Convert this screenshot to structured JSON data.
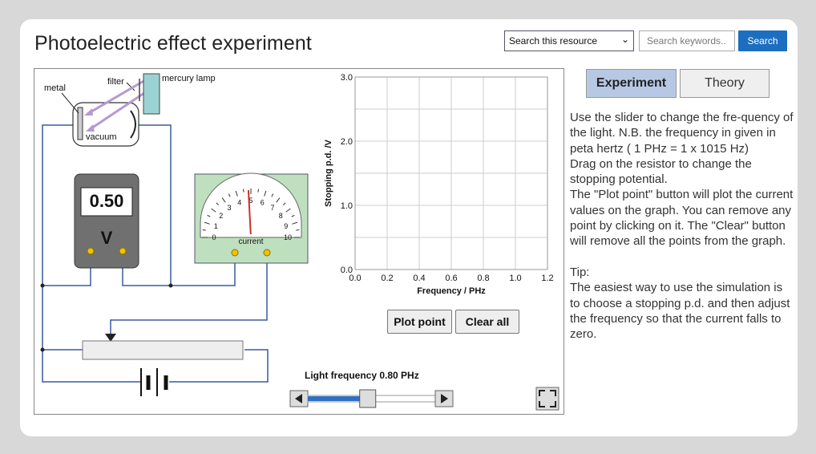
{
  "header": {
    "title": "Photoelectric effect experiment",
    "search_select": "Search this resource",
    "search_placeholder": "Search keywords..",
    "search_button": "Search"
  },
  "apparatus": {
    "metal_label": "metal",
    "filter_label": "filter",
    "lamp_label": "mercury lamp",
    "vacuum_label": "vacuum",
    "voltmeter_reading": "0.50",
    "voltmeter_unit": "V",
    "ammeter_label": "current",
    "ammeter_scale": [
      "0",
      "1",
      "2",
      "3",
      "4",
      "5",
      "6",
      "7",
      "8",
      "9",
      "10"
    ],
    "ammeter_needle_value": 5
  },
  "chart_data": {
    "type": "scatter",
    "xlabel": "Frequency / PHz",
    "ylabel": "Stopping p.d. /V",
    "xlim": [
      0,
      1.2
    ],
    "ylim": [
      0,
      3.0
    ],
    "x_ticks": [
      "0.0",
      "0.2",
      "0.4",
      "0.6",
      "0.8",
      "1.0",
      "1.2"
    ],
    "y_ticks": [
      "0.0",
      "1.0",
      "2.0",
      "3.0"
    ],
    "grid": true,
    "points": []
  },
  "controls": {
    "plot_point": "Plot point",
    "clear_all": "Clear all",
    "frequency_label": "Light frequency 0.80 PHz",
    "frequency_value": 0.8,
    "frequency_slider_fraction": 0.47
  },
  "tabs": {
    "experiment": "Experiment",
    "theory": "Theory"
  },
  "instructions": {
    "para1": "Use the slider to change the fre-quency of the light. N.B. the frequency in given in peta hertz ( 1 PHz = 1 x 1015 Hz)",
    "para2": "Drag on the resistor to change the stopping potential.",
    "para3": "The \"Plot point\" button will plot the current values on the graph. You can remove any point by clicking on it. The \"Clear\" button will remove all the points from the graph.",
    "tip_heading": "Tip:",
    "tip_text": "The easiest way to use the simulation is to choose a stopping p.d. and then adjust the frequency so that the current falls to zero."
  }
}
